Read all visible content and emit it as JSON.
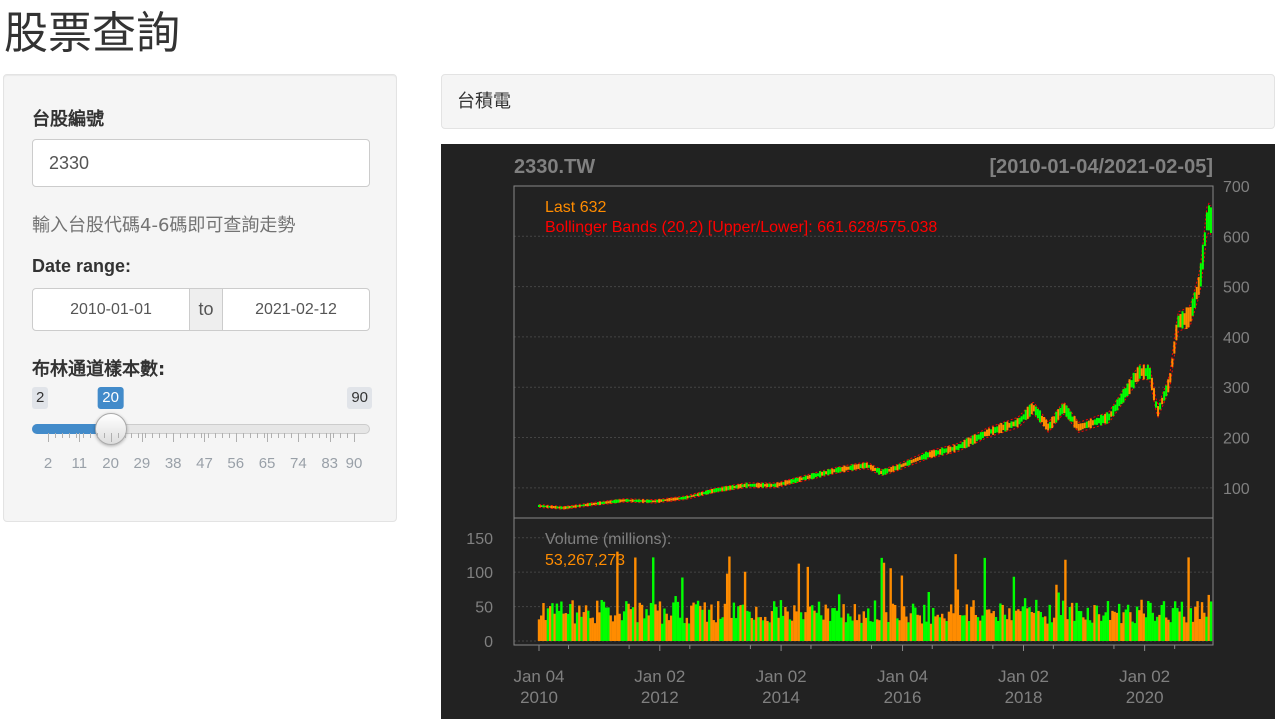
{
  "page": {
    "title": "股票查詢"
  },
  "sidebar": {
    "stock_label": "台股編號",
    "stock_value": "2330",
    "help_text": "輸入台股代碼4-6碼即可查詢走勢",
    "date_label": "Date range:",
    "date_start": "2010-01-01",
    "date_sep": "to",
    "date_end": "2021-02-12",
    "slider_label": "布林通道樣本數:",
    "slider": {
      "min": 2,
      "max": 90,
      "value": 20,
      "min_label": "2",
      "max_label": "90",
      "value_label": "20",
      "ticks": [
        "2",
        "11",
        "20",
        "29",
        "38",
        "47",
        "56",
        "65",
        "74",
        "83",
        "90"
      ]
    }
  },
  "main": {
    "stock_name": "台積電"
  },
  "chart_data": {
    "type": "line",
    "title": "2330.TW",
    "date_range_label": "[2010-01-04/2021-02-05]",
    "last_label": "Last 632",
    "bbands_label": "Bollinger Bands (20,2) [Upper/Lower]: 661.628/575.038",
    "volume_label": "Volume (millions):",
    "volume_last": "53,267,273",
    "price_axis": {
      "ticks": [
        100,
        200,
        300,
        400,
        500,
        600,
        700
      ],
      "ylim": [
        40,
        700
      ]
    },
    "volume_axis": {
      "ticks": [
        0,
        50,
        100,
        150
      ],
      "ylim": [
        0,
        170
      ]
    },
    "x_ticks": [
      {
        "date": "2010-01-04",
        "line1": "Jan 04",
        "line2": "2010"
      },
      {
        "date": "2012-01-02",
        "line1": "Jan 02",
        "line2": "2012"
      },
      {
        "date": "2014-01-02",
        "line1": "Jan 02",
        "line2": "2014"
      },
      {
        "date": "2016-01-04",
        "line1": "Jan 04",
        "line2": "2016"
      },
      {
        "date": "2018-01-02",
        "line1": "Jan 02",
        "line2": "2018"
      },
      {
        "date": "2020-01-02",
        "line1": "Jan 02",
        "line2": "2020"
      }
    ],
    "x_range": [
      "2010-01-04",
      "2021-02-05"
    ],
    "price_series": {
      "name": "Close",
      "points": [
        [
          "2010-01-04",
          64
        ],
        [
          "2010-06-01",
          60
        ],
        [
          "2010-12-01",
          68
        ],
        [
          "2011-06-01",
          75
        ],
        [
          "2011-12-01",
          73
        ],
        [
          "2012-06-01",
          80
        ],
        [
          "2012-12-01",
          95
        ],
        [
          "2013-06-01",
          105
        ],
        [
          "2013-12-01",
          105
        ],
        [
          "2014-06-01",
          120
        ],
        [
          "2014-12-01",
          135
        ],
        [
          "2015-06-01",
          145
        ],
        [
          "2015-09-01",
          130
        ],
        [
          "2015-12-01",
          140
        ],
        [
          "2016-06-01",
          165
        ],
        [
          "2016-12-01",
          180
        ],
        [
          "2017-06-01",
          210
        ],
        [
          "2017-12-01",
          230
        ],
        [
          "2018-03-01",
          260
        ],
        [
          "2018-06-01",
          220
        ],
        [
          "2018-09-01",
          260
        ],
        [
          "2018-12-01",
          220
        ],
        [
          "2019-06-01",
          240
        ],
        [
          "2019-12-01",
          330
        ],
        [
          "2020-02-01",
          330
        ],
        [
          "2020-03-20",
          250
        ],
        [
          "2020-06-01",
          310
        ],
        [
          "2020-07-20",
          430
        ],
        [
          "2020-10-01",
          440
        ],
        [
          "2020-12-01",
          510
        ],
        [
          "2021-01-15",
          640
        ],
        [
          "2021-02-05",
          632
        ]
      ]
    },
    "colors": {
      "background": "#222222",
      "up": "#00ff00",
      "down": "#ff8c00",
      "bbands": "#ff0000",
      "label": "#ff8c00",
      "axis_text": "#808080",
      "grid": "#444444"
    }
  }
}
